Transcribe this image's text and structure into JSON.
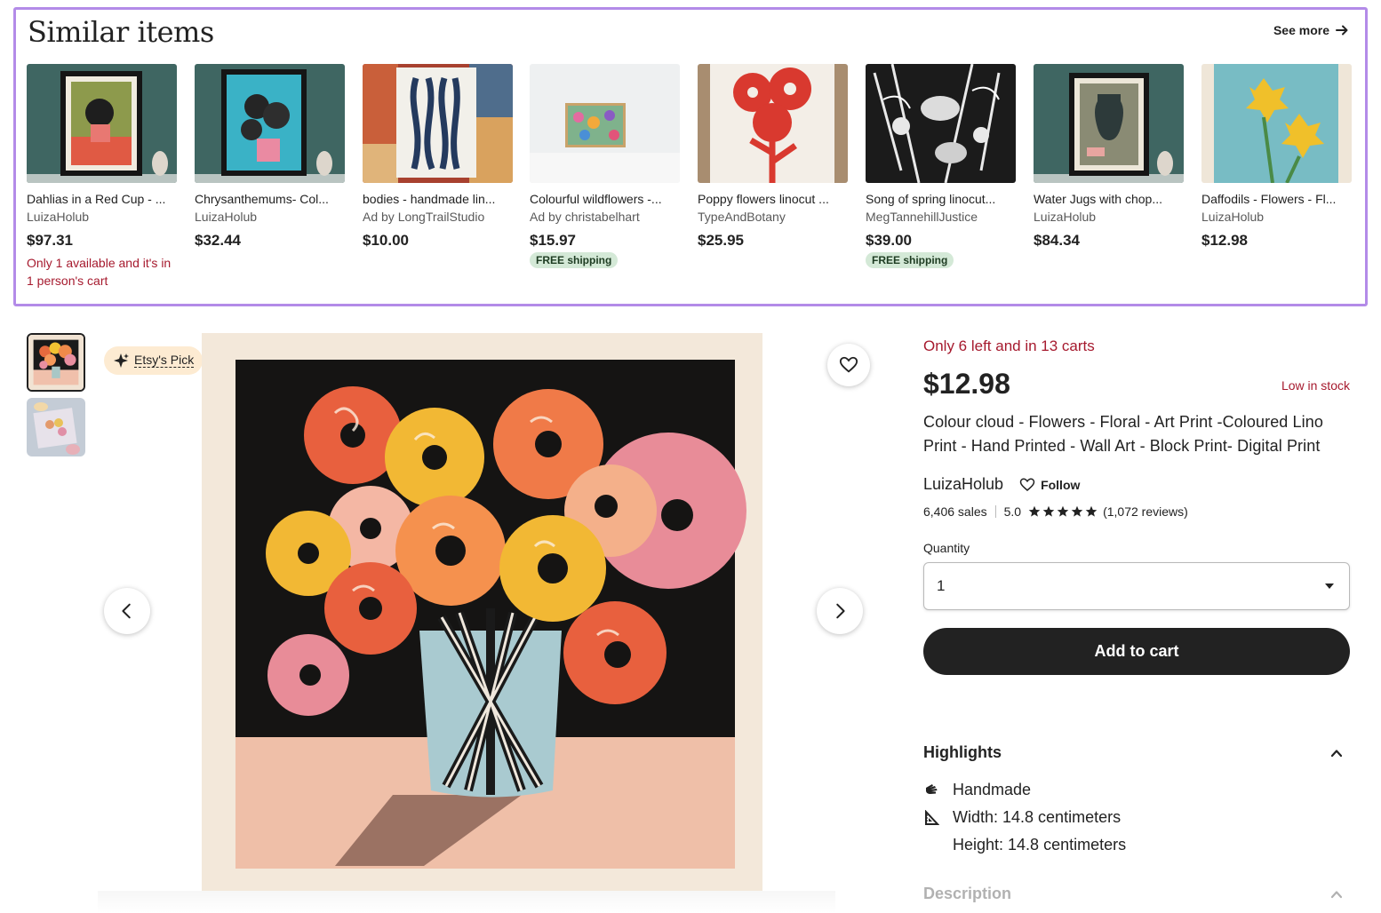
{
  "similar": {
    "title": "Similar items",
    "see_more": "See more",
    "items": [
      {
        "title": "Dahlias in a Red Cup - ...",
        "shop": "LuizaHolub",
        "price": "$97.31",
        "note": "Only 1 available and it's in 1 person's cart",
        "badge": ""
      },
      {
        "title": "Chrysanthemums- Col...",
        "shop": "LuizaHolub",
        "price": "$32.44",
        "note": "",
        "badge": ""
      },
      {
        "title": "bodies - handmade lin...",
        "shop": "Ad by LongTrailStudio",
        "price": "$10.00",
        "note": "",
        "badge": ""
      },
      {
        "title": "Colourful wildflowers -...",
        "shop": "Ad by christabelhart",
        "price": "$15.97",
        "note": "",
        "badge": "FREE shipping"
      },
      {
        "title": "Poppy flowers linocut ...",
        "shop": "TypeAndBotany",
        "price": "$25.95",
        "note": "",
        "badge": ""
      },
      {
        "title": "Song of spring linocut...",
        "shop": "MegTannehillJustice",
        "price": "$39.00",
        "note": "",
        "badge": "FREE shipping"
      },
      {
        "title": "Water Jugs with chop...",
        "shop": "LuizaHolub",
        "price": "$84.34",
        "note": "",
        "badge": ""
      },
      {
        "title": "Daffodils - Flowers - Fl...",
        "shop": "LuizaHolub",
        "price": "$12.98",
        "note": "",
        "badge": ""
      }
    ]
  },
  "gallery": {
    "pick_label": "Etsy's Pick"
  },
  "listing": {
    "stock_line": "Only 6 left and in 13 carts",
    "price": "$12.98",
    "low_stock": "Low in stock",
    "title": "Colour cloud - Flowers - Floral - Art Print -Coloured Lino Print - Hand Printed - Wall Art - Block Print- Digital Print",
    "seller": "LuizaHolub",
    "follow": "Follow",
    "sales": "6,406 sales",
    "rating": "5.0",
    "stars": 5,
    "reviews": "(1,072 reviews)",
    "quantity_label": "Quantity",
    "quantity_value": "1",
    "add_to_cart": "Add to cart",
    "highlights_title": "Highlights",
    "highlights": [
      {
        "icon": "hand-icon",
        "text": "Handmade"
      },
      {
        "icon": "ruler-triangle-icon",
        "text": "Width: 14.8 centimeters"
      },
      {
        "icon": "",
        "text": "Height: 14.8 centimeters"
      }
    ],
    "description_title": "Description"
  },
  "colors": {
    "accent_red": "#a61a2e",
    "panel_border": "#b38be8",
    "cart_button": "#222222",
    "free_shipping_bg": "#d4e9d7"
  }
}
